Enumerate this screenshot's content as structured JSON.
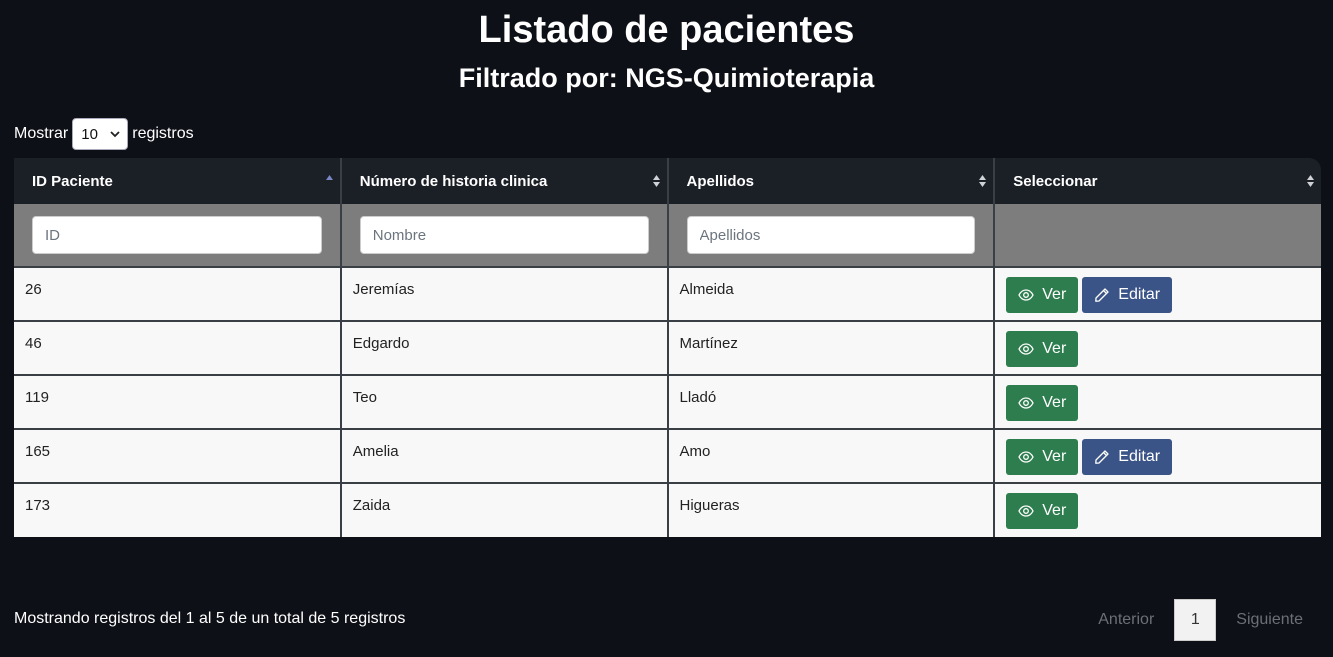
{
  "header": {
    "title": "Listado de pacientes",
    "subtitle": "Filtrado por: NGS-Quimioterapia"
  },
  "length": {
    "before": "Mostrar",
    "value": "10",
    "after": "registros"
  },
  "table": {
    "columns": [
      "ID Paciente",
      "Número de historia clinica",
      "Apellidos",
      "Seleccionar"
    ],
    "filters": {
      "id_placeholder": "ID",
      "name_placeholder": "Nombre",
      "surname_placeholder": "Apellidos"
    },
    "rows": [
      {
        "id": "26",
        "name": "Jeremías",
        "surname": "Almeida",
        "can_edit": true
      },
      {
        "id": "46",
        "name": "Edgardo",
        "surname": "Martínez",
        "can_edit": false
      },
      {
        "id": "119",
        "name": "Teo",
        "surname": "Lladó",
        "can_edit": false
      },
      {
        "id": "165",
        "name": "Amelia",
        "surname": "Amo",
        "can_edit": true
      },
      {
        "id": "173",
        "name": "Zaida",
        "surname": "Higueras",
        "can_edit": false
      }
    ],
    "buttons": {
      "view": "Ver",
      "edit": "Editar"
    }
  },
  "footer": {
    "info": "Mostrando registros del 1 al 5 de un total de 5 registros",
    "prev": "Anterior",
    "page": "1",
    "next": "Siguiente"
  },
  "colors": {
    "background": "#0d1017",
    "view_button": "#2e7d4f",
    "edit_button": "#3b5488"
  }
}
